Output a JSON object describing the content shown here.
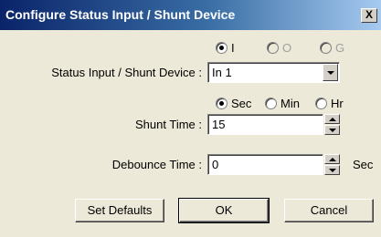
{
  "window": {
    "title": "Configure Status Input / Shunt Device",
    "close_glyph": "X"
  },
  "io_radio": [
    {
      "label": "I",
      "checked": true,
      "disabled": false
    },
    {
      "label": "O",
      "checked": false,
      "disabled": true
    },
    {
      "label": "G",
      "checked": false,
      "disabled": true
    }
  ],
  "device": {
    "label": "Status Input / Shunt Device :",
    "value": "In 1"
  },
  "units_radio": [
    {
      "label": "Sec",
      "checked": true
    },
    {
      "label": "Min",
      "checked": false
    },
    {
      "label": "Hr",
      "checked": false
    }
  ],
  "shunt": {
    "label": "Shunt Time :",
    "value": "15"
  },
  "debounce": {
    "label": "Debounce Time :",
    "value": "0",
    "unit": "Sec"
  },
  "buttons": {
    "set_defaults": "Set Defaults",
    "ok": "OK",
    "cancel": "Cancel"
  }
}
